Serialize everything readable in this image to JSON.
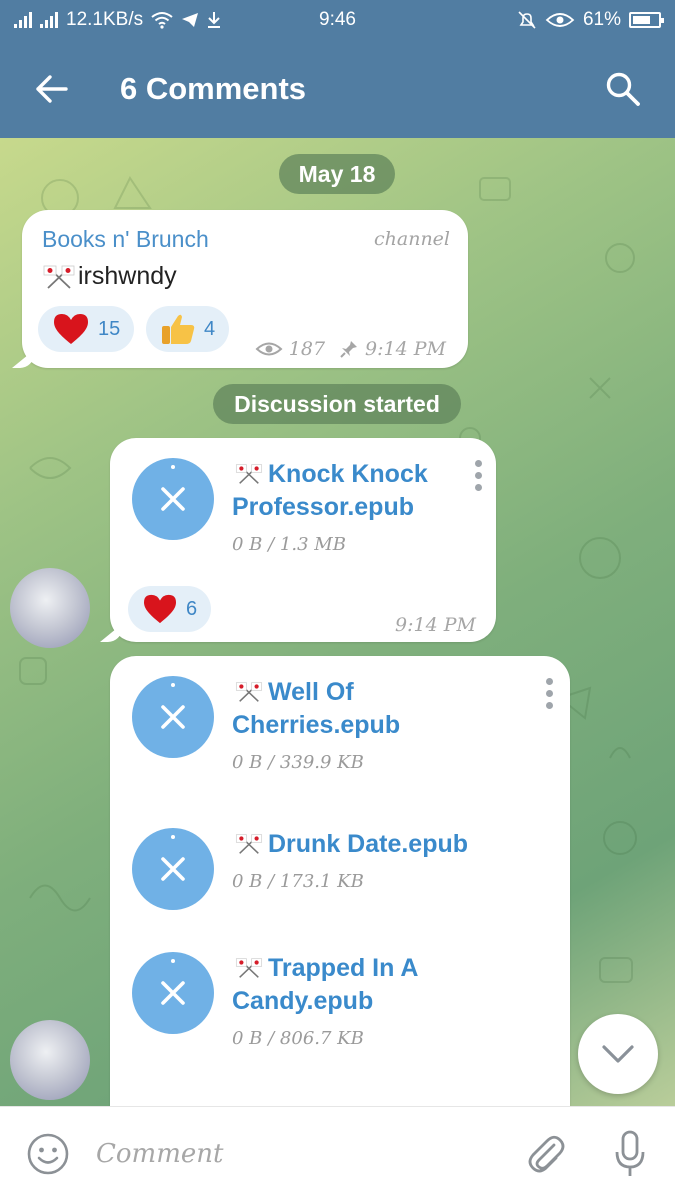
{
  "status_bar": {
    "network_speed": "12.1KB/s",
    "time": "9:46",
    "battery": "61%"
  },
  "header": {
    "title": "6 Comments",
    "back_icon": "arrow-left-icon",
    "search_icon": "search-icon"
  },
  "chat": {
    "date_pill": "May 18",
    "channel_post": {
      "channel_name": "Books n' Brunch",
      "label": "channel",
      "text": "irshwndy",
      "reactions": [
        {
          "icon": "heart-icon",
          "count": "15"
        },
        {
          "icon": "thumbs-up-icon",
          "count": "4"
        }
      ],
      "views": "187",
      "time": "9:14 PM"
    },
    "service_message": "Discussion started",
    "message_1": {
      "files": [
        {
          "name": "Knock Knock Professor.epub",
          "size": "0 B / 1.3 MB"
        }
      ],
      "reactions": [
        {
          "icon": "heart-icon",
          "count": "6"
        }
      ],
      "time": "9:14 PM"
    },
    "message_2": {
      "files": [
        {
          "name": "Well Of Cherries.epub",
          "size": "0 B / 339.9 KB"
        },
        {
          "name": "Drunk Date.epub",
          "size": "0 B / 173.1 KB"
        },
        {
          "name": "Trapped In A Candy.epub",
          "size": "0 B / 806.7 KB"
        }
      ]
    }
  },
  "input": {
    "placeholder": "Comment"
  },
  "colors": {
    "header": "#517da2",
    "accent": "#3a8acb",
    "file_icon": "#70b1e6",
    "reaction_bg": "#e4eff8"
  }
}
